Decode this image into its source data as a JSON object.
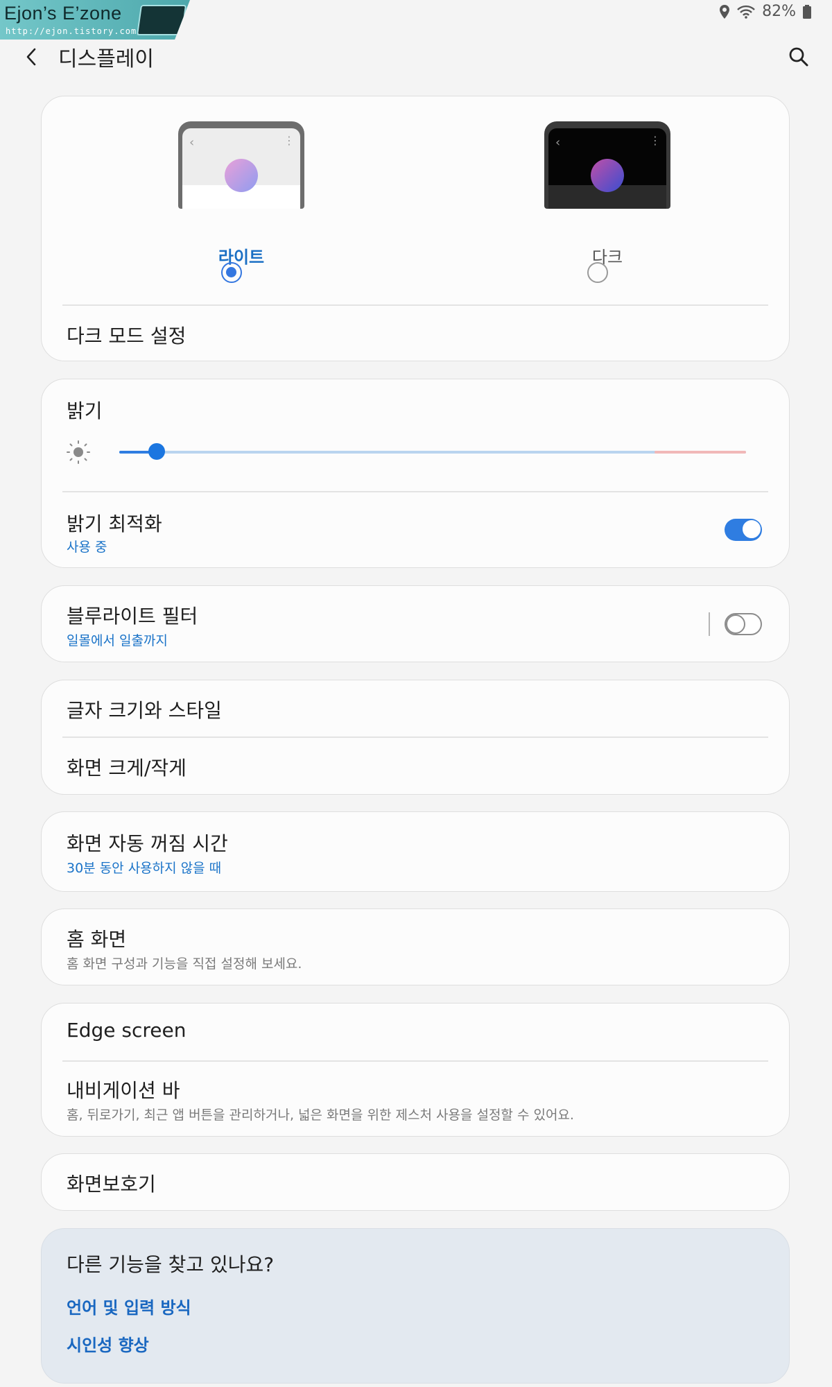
{
  "watermark": {
    "title": "Ejon’s E’zone",
    "url": "http://ejon.tistory.com/"
  },
  "status_bar": {
    "battery": "82%",
    "icons": [
      "location-icon",
      "wifi-icon",
      "battery-icon"
    ]
  },
  "header": {
    "title": "디스플레이",
    "back_icon": "chevron-left-icon",
    "search_icon": "search-icon"
  },
  "theme": {
    "light_label": "라이트",
    "dark_label": "다크",
    "selected": "light",
    "dark_mode_settings": "다크 모드 설정"
  },
  "brightness": {
    "label": "밝기",
    "level": 0.06,
    "adaptive_title": "밝기 최적화",
    "adaptive_sub": "사용 중",
    "adaptive_on": true
  },
  "blue_light": {
    "title": "블루라이트 필터",
    "sub": "일몰에서 일출까지",
    "on": false
  },
  "font_and_zoom": {
    "font_style": "글자 크기와 스타일",
    "screen_zoom": "화면 크게/작게"
  },
  "timeout": {
    "title": "화면 자동 꺼짐 시간",
    "sub": "30분 동안 사용하지 않을 때"
  },
  "home_screen": {
    "title": "홈 화면",
    "sub": "홈 화면 구성과 기능을 직접 설정해 보세요."
  },
  "edge_nav": {
    "edge": "Edge screen",
    "nav_title": "내비게이션 바",
    "nav_sub": "홈, 뒤로가기, 최근 앱 버튼을 관리하거나, 넓은 화면을 위한 제스처 사용을 설정할 수 있어요."
  },
  "screensaver": {
    "title": "화면보호기"
  },
  "looking_for": {
    "title": "다른 기능을 찾고 있나요?",
    "links": [
      "언어 및 입력 방식",
      "시인성 향상"
    ]
  },
  "colors": {
    "accent": "#1b76e0",
    "link": "#1967c0",
    "background": "#f4f4f4"
  }
}
